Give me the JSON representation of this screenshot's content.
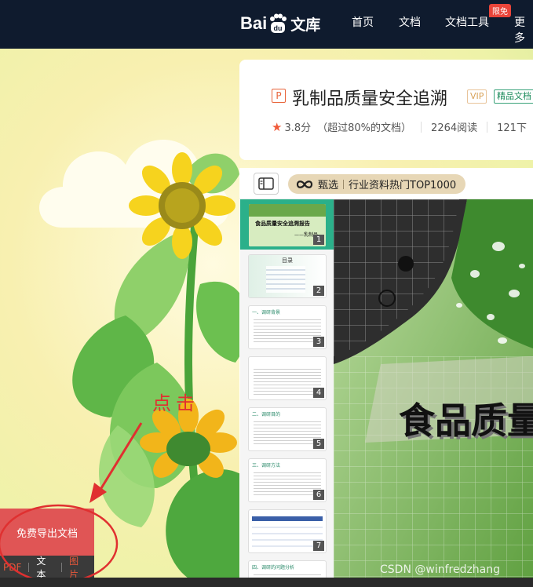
{
  "nav": {
    "logo_bai": "Bai",
    "logo_du": "du",
    "logo_wenku": "文库",
    "items": [
      "首页",
      "文档",
      "文档工具",
      "更多"
    ],
    "badge": "限免"
  },
  "doc": {
    "type_icon": "P",
    "title": "乳制品质量安全追溯",
    "vip_tag": "VIP",
    "quality_tag": "精品文档",
    "rating": "3.8分",
    "rating_note": "（超过80%的文档）",
    "reads": "2264阅读",
    "downloads": "121下"
  },
  "toolbar": {
    "pill_label": "甄选",
    "pill_text": "行业资料热门TOP1000"
  },
  "thumbs": [
    {
      "num": "1",
      "title": "食品质量安全追溯报告",
      "sub": "——乳制品"
    },
    {
      "num": "2",
      "title": "目录"
    },
    {
      "num": "3",
      "title": "一、调研背景"
    },
    {
      "num": "4",
      "title": ""
    },
    {
      "num": "5",
      "title": "二、调研目的"
    },
    {
      "num": "6",
      "title": "三、调研方法"
    },
    {
      "num": "7",
      "title": ""
    },
    {
      "num": "",
      "title": "四、调研的问题分析"
    }
  ],
  "slide": {
    "title": "食品质量"
  },
  "annotation": {
    "click": "点击"
  },
  "export": {
    "button": "免费导出文档",
    "formats": [
      "PDF",
      "文本",
      "图片"
    ]
  },
  "watermark": "CSDN @winfredzhang",
  "colors": {
    "nav_bg": "#0f1b2e",
    "accent_green": "#2bb08a",
    "export_red": "#e05555",
    "annotation_red": "#e03030",
    "pill_bg": "#e7d7b6"
  }
}
